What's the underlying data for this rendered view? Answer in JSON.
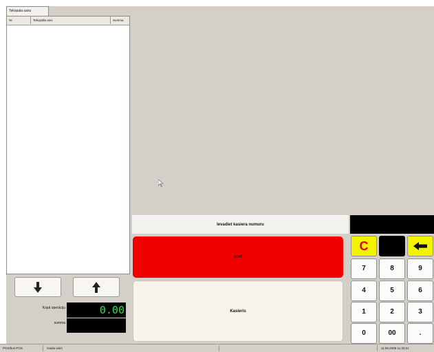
{
  "receipt": {
    "tab_label": "Tekopala sanu",
    "columns": {
      "nr": "Nr.",
      "name": "Tekopalla anis",
      "sum": "Summa"
    },
    "labels": {
      "total_ops": "Kopā operāciju",
      "summa": "summa"
    },
    "total_value": "0.00"
  },
  "prompt": {
    "message": "Ievadiet kasiera numuru",
    "red_button": "Iziet",
    "cream_button": "Kasieris"
  },
  "keypad": {
    "clear": "C",
    "keys": [
      "7",
      "8",
      "9",
      "4",
      "5",
      "6",
      "1",
      "2",
      "3",
      "0",
      "00",
      "."
    ]
  },
  "status": {
    "left": "POS/bus POS",
    "middle": "Gaida vairs",
    "right": "11.06.2009 11:33:21"
  },
  "colors": {
    "red": "#f00000",
    "yellow": "#f3f300",
    "green_digits": "#2fe03a"
  },
  "icons": [
    "arrow-down-icon",
    "arrow-up-icon",
    "backspace-arrow-icon",
    "mouse-cursor-icon"
  ]
}
